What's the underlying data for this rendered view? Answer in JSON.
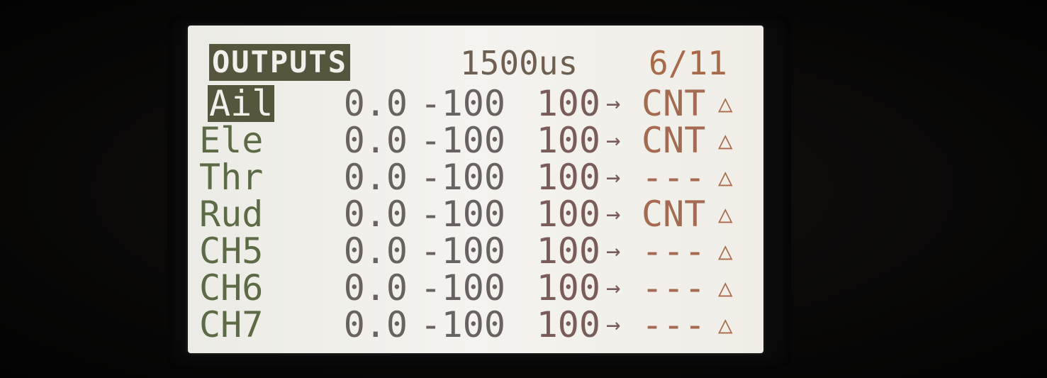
{
  "screen": {
    "title": "OUTPUTS",
    "pulse_value": "1500us",
    "page": "6/11"
  },
  "channels": [
    {
      "name": "Ail",
      "offset": "0.0",
      "min": "-100",
      "max": "100",
      "arrow": "→",
      "center": "CNT",
      "direction_icon": "△",
      "selected": true
    },
    {
      "name": "Ele",
      "offset": "0.0",
      "min": "-100",
      "max": "100",
      "arrow": "→",
      "center": "CNT",
      "direction_icon": "△",
      "selected": false
    },
    {
      "name": "Thr",
      "offset": "0.0",
      "min": "-100",
      "max": "100",
      "arrow": "→",
      "center": "---",
      "direction_icon": "△",
      "selected": false
    },
    {
      "name": "Rud",
      "offset": "0.0",
      "min": "-100",
      "max": "100",
      "arrow": "→",
      "center": "CNT",
      "direction_icon": "△",
      "selected": false
    },
    {
      "name": "CH5",
      "offset": "0.0",
      "min": "-100",
      "max": "100",
      "arrow": "→",
      "center": "---",
      "direction_icon": "△",
      "selected": false
    },
    {
      "name": "CH6",
      "offset": "0.0",
      "min": "-100",
      "max": "100",
      "arrow": "→",
      "center": "---",
      "direction_icon": "△",
      "selected": false
    },
    {
      "name": "CH7",
      "offset": "0.0",
      "min": "-100",
      "max": "100",
      "arrow": "→",
      "center": "---",
      "direction_icon": "△",
      "selected": false
    }
  ],
  "colors": {
    "lcd_background": "#f2f1ec",
    "highlight": "#56563f",
    "channel_text": "#5c6b45",
    "value_text": "#6a6260",
    "accent_text": "#a86a48"
  }
}
